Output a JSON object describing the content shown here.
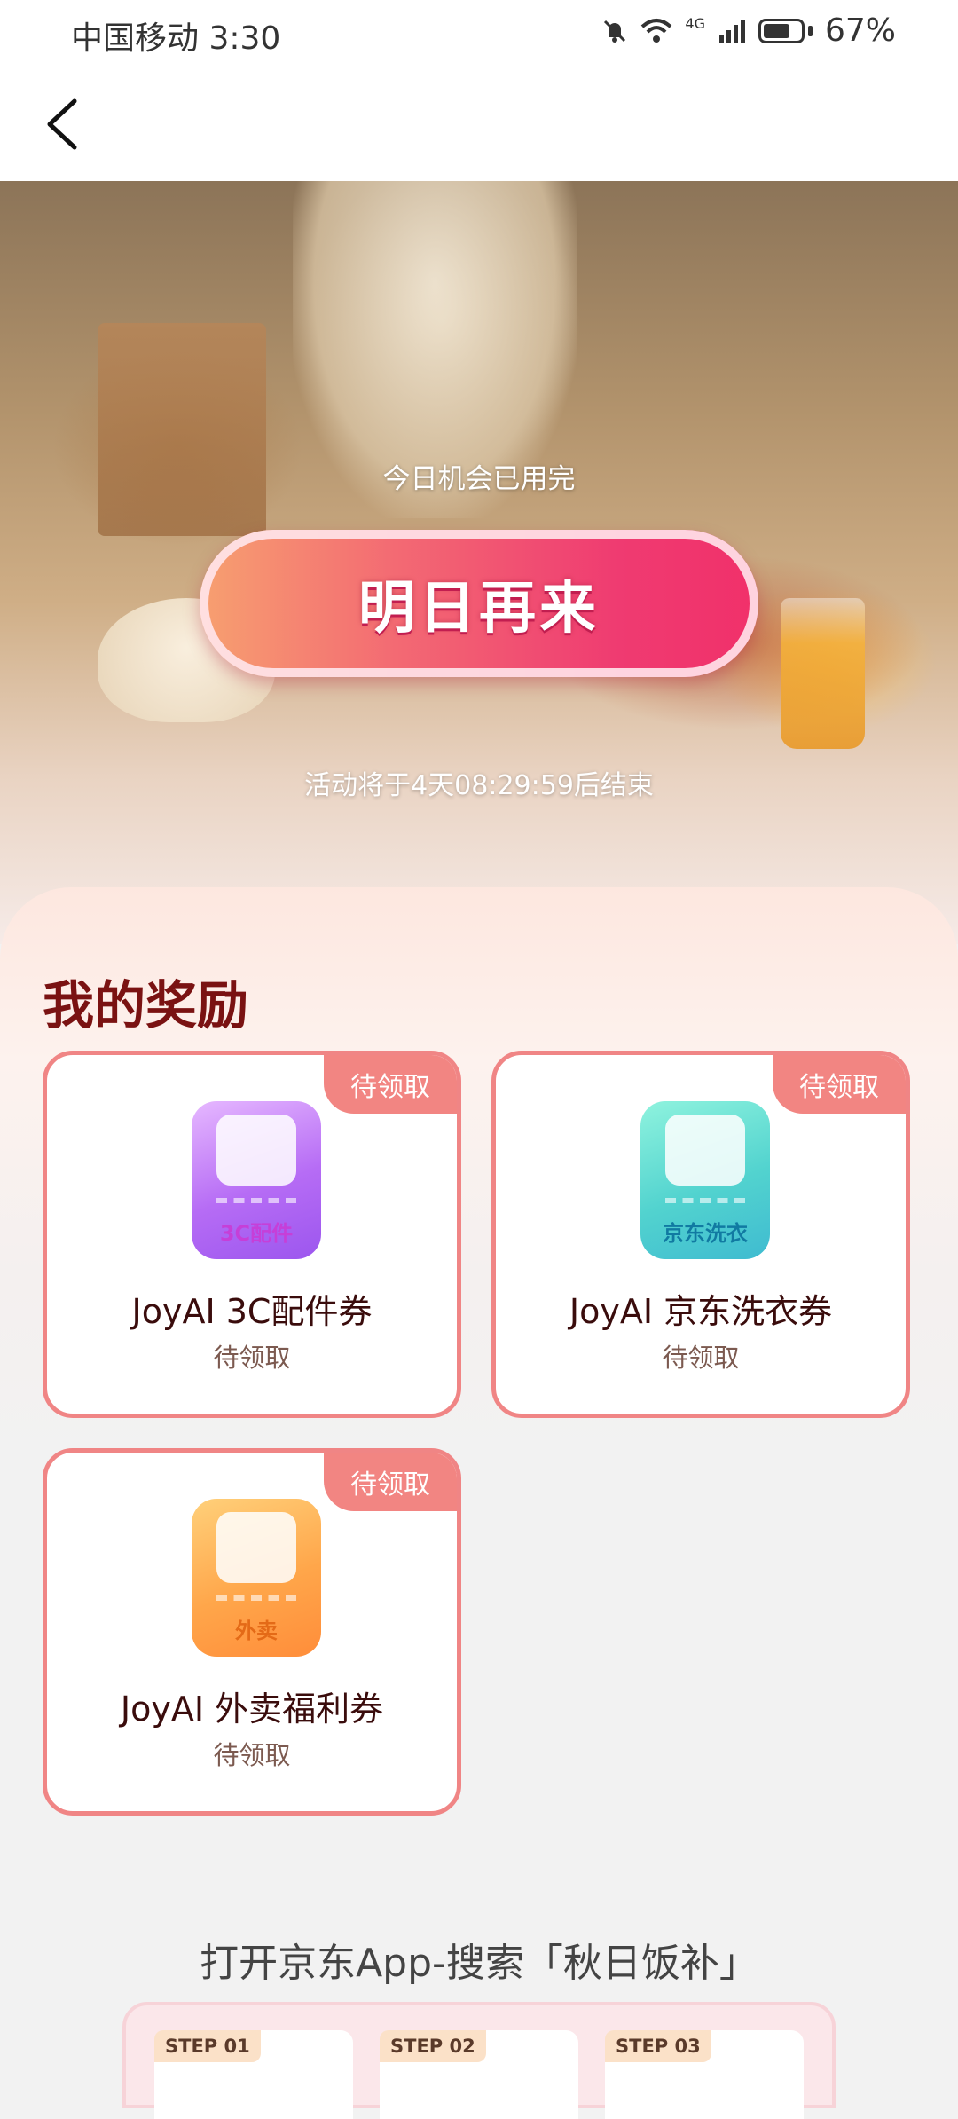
{
  "status_bar": {
    "carrier_time": "中国移动 3:30",
    "network": "4G",
    "battery": "67%"
  },
  "nav": {
    "back_icon": "chevron-left-icon"
  },
  "hero": {
    "note": "今日机会已用完",
    "cta_label": "明日再来",
    "countdown": "活动将于4天08:29:59后结束"
  },
  "rewards": {
    "title": "我的奖励",
    "items": [
      {
        "badge": "待领取",
        "icon_label": "3C配件",
        "title": "JoyAI 3C配件券",
        "status": "待领取",
        "icon": "earbuds-icon"
      },
      {
        "badge": "待领取",
        "icon_label": "京东洗衣",
        "title": "JoyAI 京东洗衣券",
        "status": "待领取",
        "icon": "laundry-basket-icon"
      },
      {
        "badge": "待领取",
        "icon_label": "外卖",
        "title": "JoyAI 外卖福利券",
        "status": "待领取",
        "icon": "food-box-icon"
      }
    ]
  },
  "instructions": {
    "title": "打开京东App-搜索「秋日饭补」",
    "steps": [
      "STEP 01",
      "STEP 02",
      "STEP 03"
    ]
  },
  "colors": {
    "card_border": "#f08585",
    "badge_bg": "#f28582",
    "title_dark_red": "#7a1212",
    "cta_pink": "#ef3b71"
  }
}
